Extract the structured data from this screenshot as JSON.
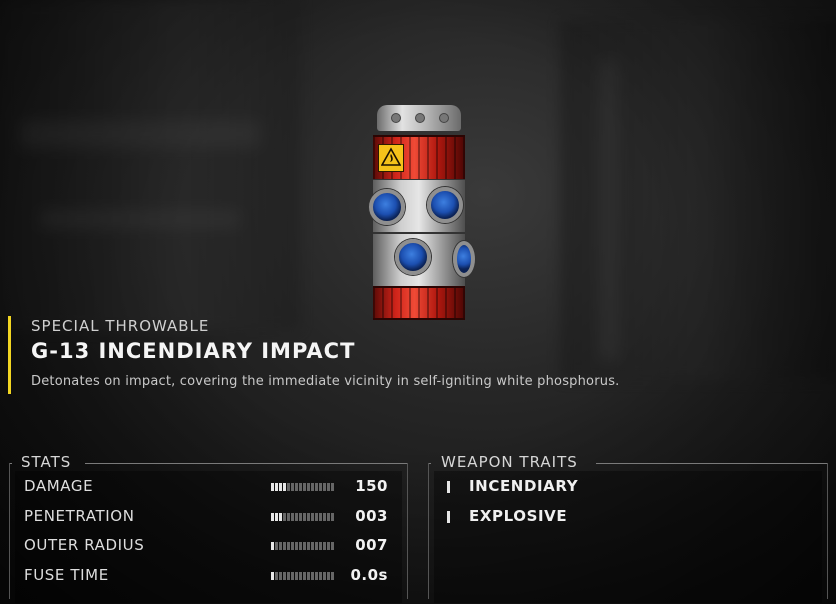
{
  "item": {
    "category": "SPECIAL THROWABLE",
    "name": "G-13 INCENDIARY IMPACT",
    "description": "Detonates on impact, covering the immediate vicinity in self-igniting white phosphorus."
  },
  "stats": {
    "title": "STATS",
    "rows": [
      {
        "label": "DAMAGE",
        "value": "150",
        "bar_fill": 0.25
      },
      {
        "label": "PENETRATION",
        "value": "003",
        "bar_fill": 0.19
      },
      {
        "label": "OUTER RADIUS",
        "value": "007",
        "bar_fill": 0.06
      },
      {
        "label": "FUSE TIME",
        "value": "0.0s",
        "bar_fill": 0.06
      }
    ]
  },
  "traits": {
    "title": "WEAPON TRAITS",
    "items": [
      "INCENDIARY",
      "EXPLOSIVE"
    ]
  },
  "colors": {
    "accent": "#f2d622",
    "grenade_red": "#d0241a",
    "grenade_blue": "#3d7fe0"
  },
  "icons": {
    "hazard": "fire-warning-icon"
  }
}
